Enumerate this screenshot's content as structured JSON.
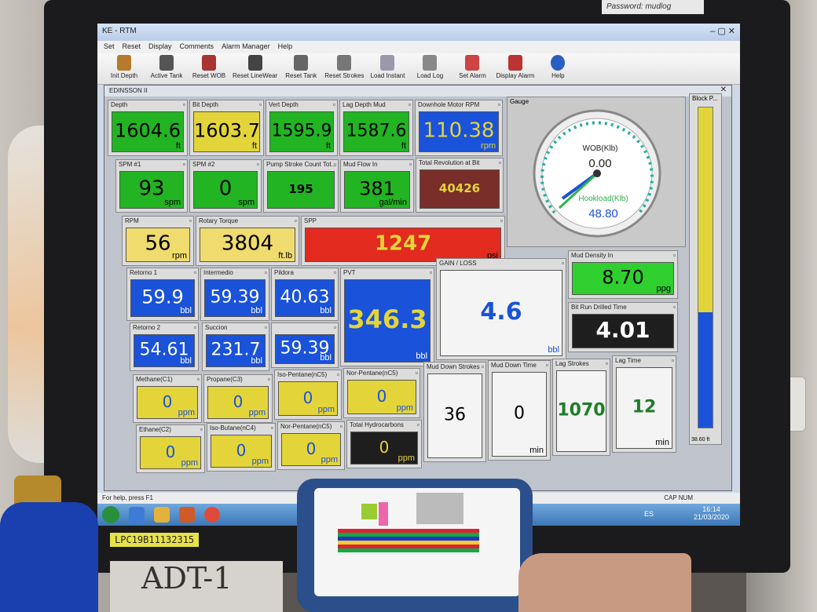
{
  "app": {
    "title": "KE - RTM",
    "subtitle": "EDINSSON II"
  },
  "menu": [
    "Set",
    "Reset",
    "Display",
    "Comments",
    "Alarm Manager",
    "Help"
  ],
  "toolbar": [
    "Init Depth",
    "Active Tank",
    "Reset WOB",
    "Reset LineWear",
    "Reset Tank",
    "Reset Strokes",
    "Load Instant",
    "Load Log",
    "Set Alarm",
    "Display Alarm",
    "Help"
  ],
  "tiles": {
    "depth": {
      "label": "Depth",
      "value": "1604.6",
      "unit": "ft"
    },
    "bit_depth": {
      "label": "Bit Depth",
      "value": "1603.7",
      "unit": "ft"
    },
    "vert_depth": {
      "label": "Vert Depth",
      "value": "1595.9",
      "unit": "ft"
    },
    "lag_depth": {
      "label": "Lag Depth Mud",
      "value": "1587.6",
      "unit": "ft"
    },
    "motor_rpm": {
      "label": "Downhole Motor RPM",
      "value": "110.38",
      "unit": "rpm"
    },
    "spm1": {
      "label": "SPM #1",
      "value": "93",
      "unit": "spm"
    },
    "spm2": {
      "label": "SPM #2",
      "value": "0",
      "unit": "spm"
    },
    "pump_count": {
      "label": "Pump Stroke Count Tot...",
      "value": "195",
      "unit": ""
    },
    "mud_flow": {
      "label": "Mud Flow In",
      "value": "381",
      "unit": "gal/min"
    },
    "total_rev": {
      "label": "Total Revolution at Bit",
      "value": "40426",
      "unit": ""
    },
    "rpm": {
      "label": "RPM",
      "value": "56",
      "unit": "rpm"
    },
    "torque": {
      "label": "Rotary Torque",
      "value": "3804",
      "unit": "ft.lb"
    },
    "spp": {
      "label": "SPP",
      "value": "1247",
      "unit": "psi"
    },
    "retorno1": {
      "label": "Retorno 1",
      "value": "59.9",
      "unit": "bbl"
    },
    "intermedio": {
      "label": "Intermedio",
      "value": "59.39",
      "unit": "bbl"
    },
    "pildora": {
      "label": "Pildora",
      "value": "40.63",
      "unit": "bbl"
    },
    "pvt": {
      "label": "PVT",
      "value": "346.3",
      "unit": "bbl"
    },
    "gain_loss": {
      "label": "GAIN / LOSS",
      "value": "4.6",
      "unit": "bbl"
    },
    "mud_density": {
      "label": "Mud Density In",
      "value": "8.70",
      "unit": "ppg"
    },
    "retorno2": {
      "label": "Retorno 2",
      "value": "54.61",
      "unit": "bbl"
    },
    "succion": {
      "label": "Succion",
      "value": "231.7",
      "unit": "bbl"
    },
    "tank7": {
      "label": "",
      "value": "59.39",
      "unit": "bbl"
    },
    "bit_run": {
      "label": "Bit Run Drilled Time",
      "value": "4.01",
      "unit": ""
    },
    "methane": {
      "label": "Methane(C1)",
      "value": "0",
      "unit": "ppm"
    },
    "propane": {
      "label": "Propane(C3)",
      "value": "0",
      "unit": "ppm"
    },
    "isopentane": {
      "label": "Iso-Pentane(nC5)",
      "value": "0",
      "unit": "ppm"
    },
    "npentane": {
      "label": "Nor-Pentane(nC5)",
      "value": "0",
      "unit": "ppm"
    },
    "ethane": {
      "label": "Ethane(C2)",
      "value": "0",
      "unit": "ppm"
    },
    "isobutane": {
      "label": "Iso-Butane(nC4)",
      "value": "0",
      "unit": "ppm"
    },
    "nbutane": {
      "label": "Nor-Pentane(nC5)",
      "value": "0",
      "unit": "ppm"
    },
    "total_hc": {
      "label": "Total Hydrocarbons",
      "value": "0",
      "unit": "ppm"
    },
    "mud_down_strokes": {
      "label": "Mud Down Strokes",
      "value": "36",
      "unit": ""
    },
    "mud_down_time": {
      "label": "Mud Down Time",
      "value": "0",
      "unit": "min"
    },
    "lag_strokes": {
      "label": "Lag Strokes",
      "value": "1070",
      "unit": ""
    },
    "lag_time": {
      "label": "Lag Time",
      "value": "12",
      "unit": "min"
    }
  },
  "gauge": {
    "label": "Gauge",
    "wob_label": "WOB(Klb)",
    "wob_value": "0.00",
    "hook_label": "Hookload(Klb)",
    "hook_value": "48.80"
  },
  "blockbar": {
    "label": "Block P...",
    "value": "38.60 ft",
    "fill_fraction": 0.36
  },
  "status": {
    "left": "For help, press F1",
    "right": "CAP  NUM"
  },
  "taskbar": {
    "lang": "ES",
    "time": "16:14",
    "date": "21/03/2020"
  },
  "stickers": {
    "top": "Password: mudlog",
    "bezel": "LPC19B11132315",
    "handwriting": "ADT-1"
  }
}
